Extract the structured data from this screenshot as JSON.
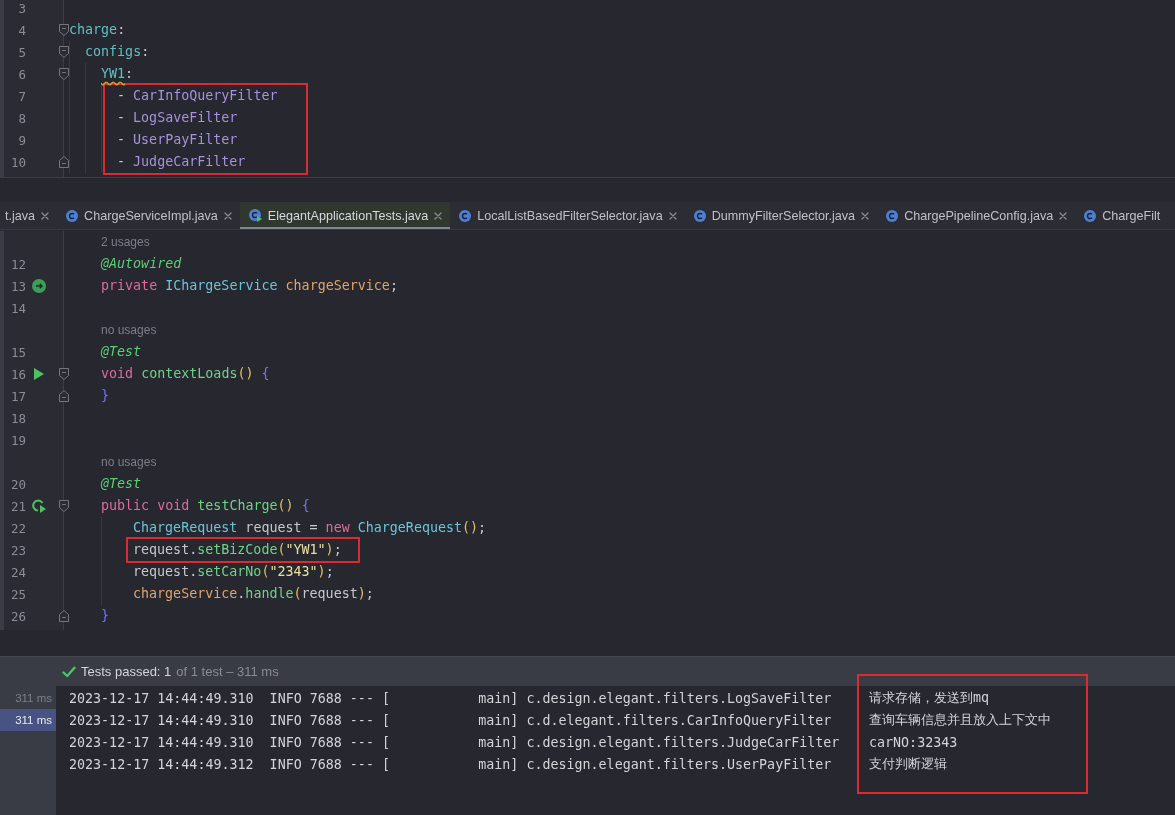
{
  "yaml_editor": {
    "lines": [
      {
        "kind": "code",
        "number": "3",
        "highlighted": false
      },
      {
        "kind": "code",
        "number": "4",
        "fold": {
          "kind": "start"
        },
        "highlighted": false,
        "tokens": [
          {
            "text": "charge",
            "kind": "key"
          },
          {
            "text": ":",
            "kind": "punct"
          }
        ],
        "children": [
          {
            "kind": "code",
            "number": "5",
            "fold": {
              "kind": "start"
            },
            "highlighted": false,
            "tokens": [
              {
                "text": "configs",
                "kind": "key"
              },
              {
                "text": ":",
                "kind": "punct"
              }
            ],
            "children": [
              {
                "kind": "code",
                "number": "6",
                "fold": {
                  "kind": "start"
                },
                "highlighted": false,
                "tokens": [
                  {
                    "text": "YW1",
                    "kind": "flagged-key"
                  },
                  {
                    "text": ":",
                    "kind": "punct"
                  }
                ],
                "children": [
                  {
                    "kind": "code",
                    "number": "7",
                    "highlighted": true,
                    "tokens": [
                      {
                        "text": "-",
                        "kind": "punct"
                      },
                      {
                        "text": " CarInfoQueryFilter",
                        "kind": "item"
                      }
                    ]
                  },
                  {
                    "kind": "code",
                    "number": "8",
                    "highlighted": true,
                    "tokens": [
                      {
                        "text": "-",
                        "kind": "punct"
                      },
                      {
                        "text": " LogSaveFilter",
                        "kind": "item"
                      }
                    ]
                  },
                  {
                    "kind": "code",
                    "number": "9",
                    "highlighted": true,
                    "tokens": [
                      {
                        "text": "-",
                        "kind": "punct"
                      },
                      {
                        "text": " UserPayFilter",
                        "kind": "item"
                      }
                    ]
                  },
                  {
                    "kind": "code",
                    "number": "10",
                    "fold": {
                      "kind": "end"
                    },
                    "highlighted": true,
                    "tokens": [
                      {
                        "text": "-",
                        "kind": "punct"
                      },
                      {
                        "text": " JudgeCarFilter",
                        "kind": "item"
                      }
                    ]
                  }
                ]
              }
            ]
          }
        ]
      }
    ]
  },
  "tabs": [
    {
      "label": "t.java",
      "kind": "cut-left",
      "selected": false
    },
    {
      "label": "ChargeServiceImpl.java",
      "kind": "class",
      "selected": false
    },
    {
      "label": "ElegantApplicationTests.java",
      "kind": "test",
      "selected": true
    },
    {
      "label": "LocalListBasedFilterSelector.java",
      "kind": "class",
      "selected": false
    },
    {
      "label": "DummyFilterSelector.java",
      "kind": "class",
      "selected": false
    },
    {
      "label": "ChargePipelineConfig.java",
      "kind": "class",
      "selected": false
    },
    {
      "label": "ChargeFilt",
      "kind": "cut-right",
      "selected": false
    }
  ],
  "java_editor": {
    "lines": [
      {
        "kind": "hint",
        "text": "2 usages",
        "highlighted": false
      },
      {
        "kind": "code",
        "number": "12",
        "highlighted": false,
        "tokens": [
          {
            "text": "@Autowired",
            "kind": "annotation"
          }
        ]
      },
      {
        "kind": "code",
        "number": "13",
        "marker": {
          "kind": "bean"
        },
        "highlighted": false,
        "tokens": [
          {
            "text": "private",
            "kind": "keyword"
          },
          {
            "text": " IChargeService",
            "kind": "type"
          },
          {
            "text": " chargeService",
            "kind": "field"
          },
          {
            "text": ";",
            "kind": "punct"
          }
        ]
      },
      {
        "kind": "code",
        "number": "14",
        "highlighted": false
      },
      {
        "kind": "hint",
        "text": "no usages",
        "highlighted": false
      },
      {
        "kind": "code",
        "number": "15",
        "highlighted": false,
        "tokens": [
          {
            "text": "@Test",
            "kind": "annotation"
          }
        ]
      },
      {
        "kind": "code",
        "number": "16",
        "marker": {
          "kind": "run"
        },
        "fold": {
          "kind": "start"
        },
        "highlighted": false,
        "tokens": [
          {
            "text": "void",
            "kind": "keyword"
          },
          {
            "text": " contextLoads",
            "kind": "method"
          },
          {
            "text": "()",
            "kind": "paren"
          },
          {
            "text": " {",
            "kind": "brace"
          }
        ]
      },
      {
        "kind": "code",
        "number": "17",
        "fold": {
          "kind": "end"
        },
        "highlighted": false,
        "tokens": [
          {
            "text": "}",
            "kind": "brace"
          }
        ]
      },
      {
        "kind": "code",
        "number": "18",
        "highlighted": false
      },
      {
        "kind": "code",
        "number": "19",
        "highlighted": false
      },
      {
        "kind": "hint",
        "text": "no usages",
        "highlighted": false
      },
      {
        "kind": "code",
        "number": "20",
        "highlighted": false,
        "tokens": [
          {
            "text": "@Test",
            "kind": "annotation"
          }
        ]
      },
      {
        "kind": "code",
        "number": "21",
        "marker": {
          "kind": "rerun"
        },
        "fold": {
          "kind": "start"
        },
        "highlighted": false,
        "tokens": [
          {
            "text": "public",
            "kind": "keyword"
          },
          {
            "text": " void",
            "kind": "keyword"
          },
          {
            "text": " testCharge",
            "kind": "method"
          },
          {
            "text": "()",
            "kind": "paren"
          },
          {
            "text": " {",
            "kind": "brace"
          }
        ],
        "children": [
          {
            "kind": "code",
            "number": "22",
            "highlighted": false,
            "tokens": [
              {
                "text": "ChargeRequest",
                "kind": "type"
              },
              {
                "text": " request",
                "kind": "plain"
              },
              {
                "text": " =",
                "kind": "punct"
              },
              {
                "text": " new",
                "kind": "keyword"
              },
              {
                "text": " ChargeRequest",
                "kind": "type"
              },
              {
                "text": "()",
                "kind": "paren"
              },
              {
                "text": ";",
                "kind": "punct"
              }
            ]
          },
          {
            "kind": "code",
            "number": "23",
            "highlighted": true,
            "tokens": [
              {
                "text": "request",
                "kind": "plain"
              },
              {
                "text": ".",
                "kind": "punct"
              },
              {
                "text": "setBizCode",
                "kind": "method"
              },
              {
                "text": "(",
                "kind": "paren"
              },
              {
                "text": "\"YW1\"",
                "kind": "string"
              },
              {
                "text": ")",
                "kind": "paren"
              },
              {
                "text": ";",
                "kind": "punct"
              }
            ]
          },
          {
            "kind": "code",
            "number": "24",
            "highlighted": false,
            "tokens": [
              {
                "text": "request",
                "kind": "plain"
              },
              {
                "text": ".",
                "kind": "punct"
              },
              {
                "text": "setCarNo",
                "kind": "method"
              },
              {
                "text": "(",
                "kind": "paren"
              },
              {
                "text": "\"2343\"",
                "kind": "string"
              },
              {
                "text": ")",
                "kind": "paren"
              },
              {
                "text": ";",
                "kind": "punct"
              }
            ]
          },
          {
            "kind": "code",
            "number": "25",
            "highlighted": false,
            "tokens": [
              {
                "text": "chargeService",
                "kind": "field"
              },
              {
                "text": ".",
                "kind": "punct"
              },
              {
                "text": "handle",
                "kind": "method"
              },
              {
                "text": "(",
                "kind": "paren"
              },
              {
                "text": "request",
                "kind": "plain"
              },
              {
                "text": ")",
                "kind": "paren"
              },
              {
                "text": ";",
                "kind": "punct"
              }
            ]
          }
        ]
      },
      {
        "kind": "code",
        "number": "26",
        "fold": {
          "kind": "end"
        },
        "highlighted": false,
        "tokens": [
          {
            "text": "}",
            "kind": "brace"
          }
        ]
      }
    ]
  },
  "test_results": {
    "status": "Tests passed: 1",
    "detail": "of 1 test – 311 ms",
    "durations": [
      {
        "label": "311 ms",
        "selected": false
      },
      {
        "label": "311 ms",
        "selected": true
      }
    ],
    "log": [
      {
        "text": "2023-12-17 14:44:49.310  INFO 7688 --- [           main] c.design.elegant.filters.LogSaveFilter",
        "message": "请求存储，发送到mq",
        "highlighted": true
      },
      {
        "text": "2023-12-17 14:44:49.310  INFO 7688 --- [           main] c.d.elegant.filters.CarInfoQueryFilter",
        "message": "查询车辆信息并且放入上下文中",
        "highlighted": true
      },
      {
        "text": "2023-12-17 14:44:49.310  INFO 7688 --- [           main] c.design.elegant.filters.JudgeCarFilter",
        "message": "carNO:32343",
        "highlighted": true
      },
      {
        "text": "2023-12-17 14:44:49.312  INFO 7688 --- [           main] c.design.elegant.filters.UserPayFilter",
        "message": "支付判断逻辑",
        "highlighted": true
      }
    ]
  }
}
